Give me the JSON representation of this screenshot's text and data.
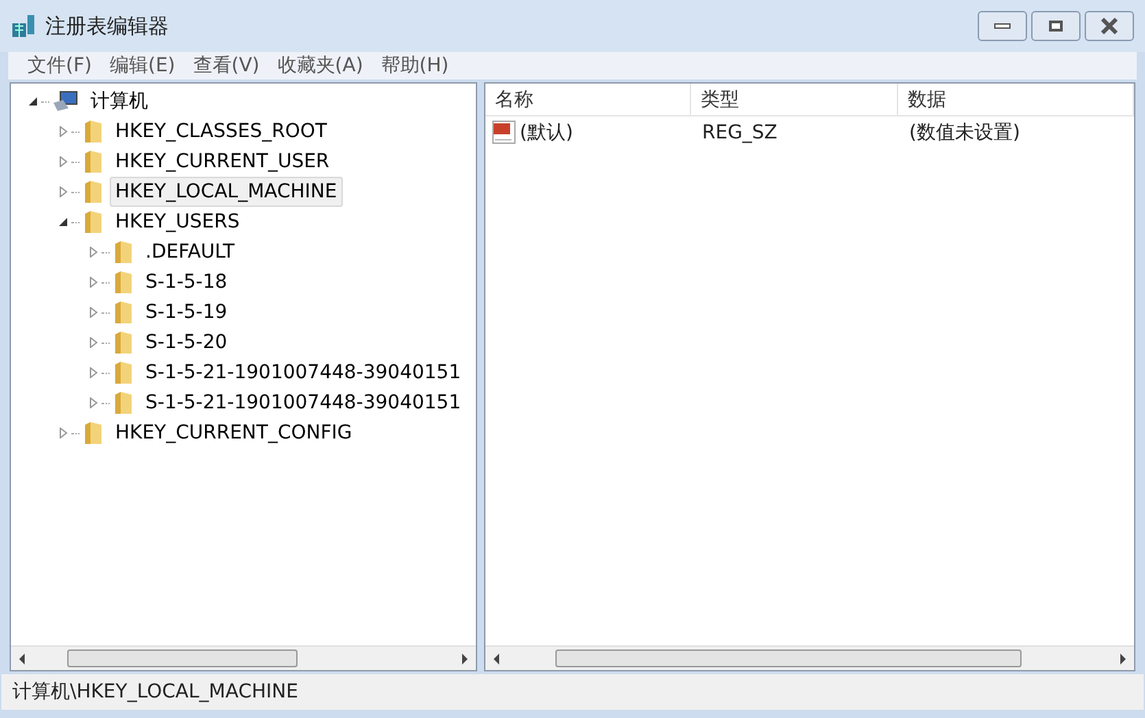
{
  "window": {
    "title": "注册表编辑器"
  },
  "menu": [
    "文件(F)",
    "编辑(E)",
    "查看(V)",
    "收藏夹(A)",
    "帮助(H)"
  ],
  "tree": [
    {
      "label": "计算机",
      "kind": "computer",
      "expanded": true,
      "selected": false,
      "children": [
        {
          "label": "HKEY_CLASSES_ROOT",
          "kind": "folder",
          "expanded": false,
          "selected": false
        },
        {
          "label": "HKEY_CURRENT_USER",
          "kind": "folder",
          "expanded": false,
          "selected": false
        },
        {
          "label": "HKEY_LOCAL_MACHINE",
          "kind": "folder",
          "expanded": false,
          "selected": true
        },
        {
          "label": "HKEY_USERS",
          "kind": "folder",
          "expanded": true,
          "selected": false,
          "children": [
            {
              "label": ".DEFAULT",
              "kind": "folder",
              "expanded": false,
              "selected": false
            },
            {
              "label": "S-1-5-18",
              "kind": "folder",
              "expanded": false,
              "selected": false
            },
            {
              "label": "S-1-5-19",
              "kind": "folder",
              "expanded": false,
              "selected": false
            },
            {
              "label": "S-1-5-20",
              "kind": "folder",
              "expanded": false,
              "selected": false
            },
            {
              "label": "S-1-5-21-1901007448-39040151",
              "kind": "folder",
              "expanded": false,
              "selected": false
            },
            {
              "label": "S-1-5-21-1901007448-39040151",
              "kind": "folder",
              "expanded": false,
              "selected": false
            }
          ]
        },
        {
          "label": "HKEY_CURRENT_CONFIG",
          "kind": "folder",
          "expanded": false,
          "selected": false
        }
      ]
    }
  ],
  "table": {
    "columns": [
      "名称",
      "类型",
      "数据"
    ],
    "rows": [
      {
        "name": "(默认)",
        "type": "REG_SZ",
        "data": "(数值未设置)"
      }
    ]
  },
  "status_bar": "计算机\\HKEY_LOCAL_MACHINE"
}
